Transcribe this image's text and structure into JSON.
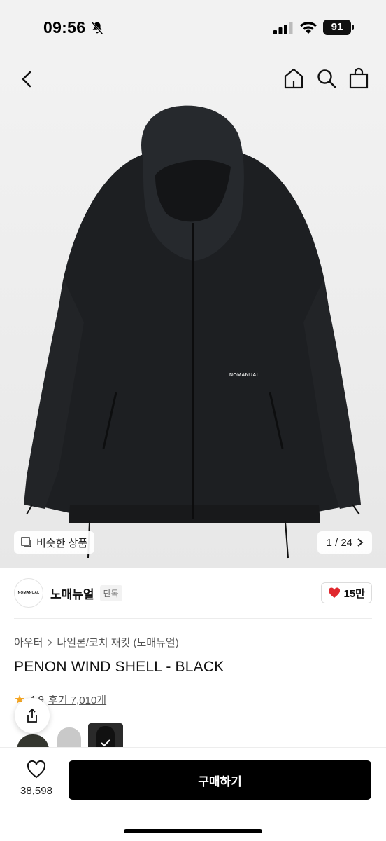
{
  "status_bar": {
    "time": "09:56",
    "battery": "91"
  },
  "gallery": {
    "similar_label": "비슷한 상품",
    "counter": "1 / 24",
    "logo_text": "NOMANUAL"
  },
  "brand": {
    "logo_text": "NOMANUAL",
    "name": "노매뉴얼",
    "tag": "단독",
    "likes": "15만"
  },
  "breadcrumb": {
    "category": "아우터",
    "subcategory": "나일론/코치 재킷 (노매뉴얼)"
  },
  "product": {
    "title": "PENON WIND SHELL - BLACK",
    "rating": "4.9",
    "reviews": "후기 7,010개"
  },
  "bottom_bar": {
    "wish_count": "38,598",
    "buy_label": "구매하기"
  },
  "icons": [
    "bell-slash-icon",
    "signal-icon",
    "wifi-icon",
    "back-icon",
    "home-icon",
    "search-icon",
    "shopping-bag-icon",
    "similar-icon",
    "chevron-right-icon",
    "heart-icon",
    "star-icon",
    "share-icon",
    "check-icon"
  ],
  "colors": {
    "accent": "#000000",
    "like": "#e0282e",
    "star": "#f5a623"
  }
}
